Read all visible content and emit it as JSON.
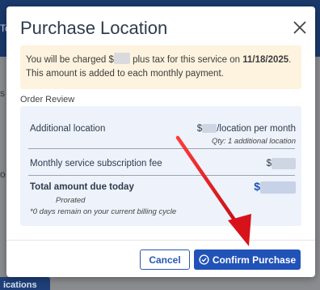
{
  "background": {
    "frag1": "To",
    "frag2": "s",
    "frag3": "o",
    "frag4": "ications"
  },
  "modal": {
    "title": "Purchase Location",
    "notice": {
      "part1": "You will be charged $",
      "part2": " plus tax for this service on ",
      "date": "11/18/2025",
      "part3": ". This amount is added to each monthly payment."
    },
    "order_review_title": "Order Review",
    "rows": {
      "additional_location": {
        "label": "Additional location",
        "value_prefix": "$",
        "value_suffix": "/location per month",
        "qty": "Qty: 1 additional location"
      },
      "subscription_fee": {
        "label": "Monthly service subscription fee",
        "value_prefix": "$"
      },
      "total": {
        "label": "Total amount due today",
        "prorated": "Prorated",
        "note": "*0 days remain on your current billing cycle",
        "value_prefix": "$"
      }
    },
    "buttons": {
      "cancel": "Cancel",
      "confirm": "Confirm Purchase"
    }
  },
  "colors": {
    "primary": "#2152b8",
    "notice_bg": "#fdf3df",
    "review_bg": "#edf2fb",
    "arrow": "#e0161d"
  },
  "icons": {
    "close": "close-icon",
    "confirm": "check-circle-icon"
  }
}
